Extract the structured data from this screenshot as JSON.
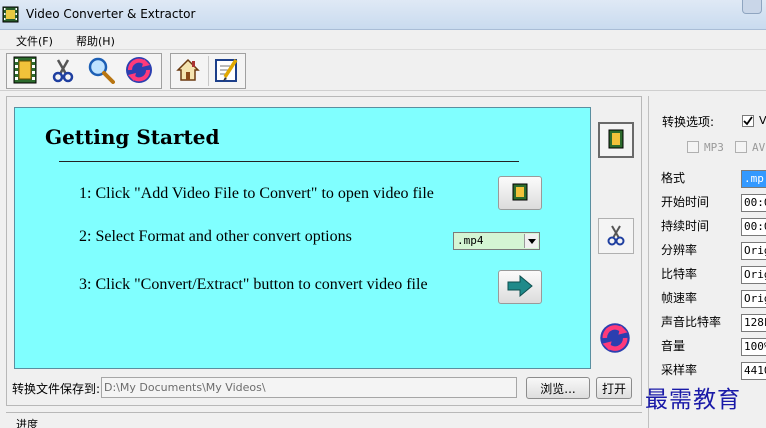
{
  "window": {
    "title": "Video Converter & Extractor"
  },
  "menu": {
    "items": [
      "文件(F)",
      "帮助(H)"
    ]
  },
  "toolbar": {
    "buttons": [
      "film-icon",
      "scissors-icon",
      "magnifier-icon",
      "convert-icon",
      "home-icon",
      "edit-icon"
    ]
  },
  "getting_started": {
    "title": "Getting Started",
    "step1": "1: Click \"Add Video File to Convert\" to open video file",
    "step2": "2: Select Format and other convert options",
    "step3": "3: Click \"Convert/Extract\" button to convert video file",
    "format_value": ".mp4"
  },
  "save": {
    "label": "转换文件保存到:",
    "path": "D:\\My Documents\\My Videos\\",
    "browse_label": "浏览...",
    "open_label": "打开"
  },
  "progress": {
    "label": "进度"
  },
  "options": {
    "title": "转换选项:",
    "video_checkbox_label": "V",
    "mp3_label": "MP3",
    "avi_label": "AV",
    "properties": [
      {
        "label": "格式",
        "value": ".mp"
      },
      {
        "label": "开始时间",
        "value": "00:0"
      },
      {
        "label": "持续时间",
        "value": "00:0"
      },
      {
        "label": "分辨率",
        "value": "Orig"
      },
      {
        "label": "比特率",
        "value": "Orig"
      },
      {
        "label": "帧速率",
        "value": "Orig"
      },
      {
        "label": "声音比特率",
        "value": "128k"
      },
      {
        "label": "音量",
        "value": "100%"
      },
      {
        "label": "采样率",
        "value": "4410"
      }
    ]
  },
  "watermark": {
    "text": "最需教育"
  },
  "colors": {
    "panel": "#80ffff",
    "accent": "#3399ff",
    "watermark": "#1a1aa8"
  }
}
